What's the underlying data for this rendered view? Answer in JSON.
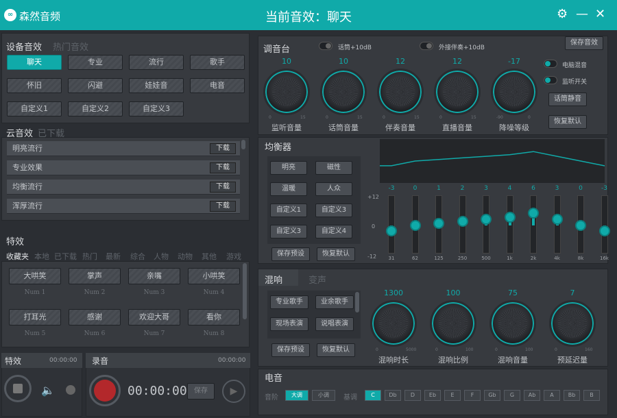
{
  "title": {
    "app": "森然音频",
    "main": "当前音效：聊天"
  },
  "device": {
    "tab_active": "设备音效",
    "tab_inactive": "热门音效",
    "buttons": [
      "聊天",
      "专业",
      "流行",
      "歌手",
      "怀旧",
      "闪避",
      "娃娃音",
      "电音",
      "自定义1",
      "自定义2",
      "自定义3"
    ],
    "active": "聊天"
  },
  "cloud": {
    "tab_active": "云音效",
    "tab_inactive": "已下载",
    "items": [
      "明亮流行",
      "专业效果",
      "均衡流行",
      "浑厚流行"
    ],
    "download": "下载"
  },
  "effects": {
    "title": "特效",
    "tags": [
      "收藏夹",
      "本地",
      "已下载",
      "热门",
      "最新",
      "综合",
      "人物",
      "动物",
      "其他",
      "游戏"
    ],
    "items": [
      {
        "label": "大哄笑",
        "num": "Num 1"
      },
      {
        "label": "掌声",
        "num": "Num 2"
      },
      {
        "label": "亲嘴",
        "num": "Num 3"
      },
      {
        "label": "小哄笑",
        "num": "Num 4"
      },
      {
        "label": "打耳光",
        "num": "Num 5"
      },
      {
        "label": "感谢",
        "num": "Num 6"
      },
      {
        "label": "欢迎大哥",
        "num": "Num 7"
      },
      {
        "label": "看你",
        "num": "Num 8"
      }
    ]
  },
  "fx_bar": {
    "title": "特效",
    "time": "00:00:00"
  },
  "record": {
    "title": "录音",
    "time_top": "00:00:00",
    "time": "00:00:00",
    "save": "保存"
  },
  "mixer": {
    "title": "调音台",
    "toggle1": "话筒+10dB",
    "toggle2": "外接伴奏+10dB",
    "save": "保存音效",
    "knobs": [
      {
        "value": "10",
        "label": "监听音量",
        "min": "0",
        "max": "15"
      },
      {
        "value": "10",
        "label": "话筒音量",
        "min": "0",
        "max": "15"
      },
      {
        "value": "12",
        "label": "伴奏音量",
        "min": "0",
        "max": "15"
      },
      {
        "value": "12",
        "label": "直播音量",
        "min": "0",
        "max": "15"
      },
      {
        "value": "-17",
        "label": "降噪等级",
        "min": "-90",
        "max": "0"
      }
    ],
    "sw1": "电脑混音",
    "sw2": "监听开关",
    "sw_btn": "话筒静音",
    "reset": "恢复默认"
  },
  "eq": {
    "title": "均衡器",
    "presets": [
      "明亮",
      "磁性",
      "温暖",
      "人众",
      "自定义1",
      "自定义3",
      "自定义3",
      "自定义4"
    ],
    "save": "保存预设",
    "reset": "恢复默认",
    "scale": [
      "+12",
      "0",
      "-12"
    ],
    "bands": [
      {
        "v": -3,
        "f": "31"
      },
      {
        "v": 0,
        "f": "62"
      },
      {
        "v": 1,
        "f": "125"
      },
      {
        "v": 2,
        "f": "250"
      },
      {
        "v": 3,
        "f": "500"
      },
      {
        "v": 4,
        "f": "1k"
      },
      {
        "v": 6,
        "f": "2k"
      },
      {
        "v": 3,
        "f": "4k"
      },
      {
        "v": 0,
        "f": "8k"
      },
      {
        "v": -3,
        "f": "16k"
      }
    ]
  },
  "reverb": {
    "tab_active": "混响",
    "tab_inactive": "变声",
    "presets": [
      "专业歌手",
      "业余歌手",
      "现场表演",
      "说唱表演"
    ],
    "save": "保存预设",
    "reset": "恢复默认",
    "knobs": [
      {
        "value": "1300",
        "label": "混响时长",
        "min": "0",
        "max": "5000"
      },
      {
        "value": "100",
        "label": "混响比例",
        "min": "0",
        "max": "100"
      },
      {
        "value": "75",
        "label": "混响音量",
        "min": "0",
        "max": "100"
      },
      {
        "value": "7",
        "label": "预延迟量",
        "min": "0",
        "max": "160"
      }
    ]
  },
  "autotune": {
    "title": "电音",
    "scale_label": "音阶",
    "major": "大调",
    "minor": "小调",
    "key_label": "基调",
    "keys": [
      "C",
      "Db",
      "D",
      "Eb",
      "E",
      "F",
      "Gb",
      "G",
      "Ab",
      "A",
      "Bb",
      "B"
    ],
    "active_key": "C"
  },
  "colors": {
    "accent": "#10aaa9",
    "bg": "#2b2e33"
  }
}
